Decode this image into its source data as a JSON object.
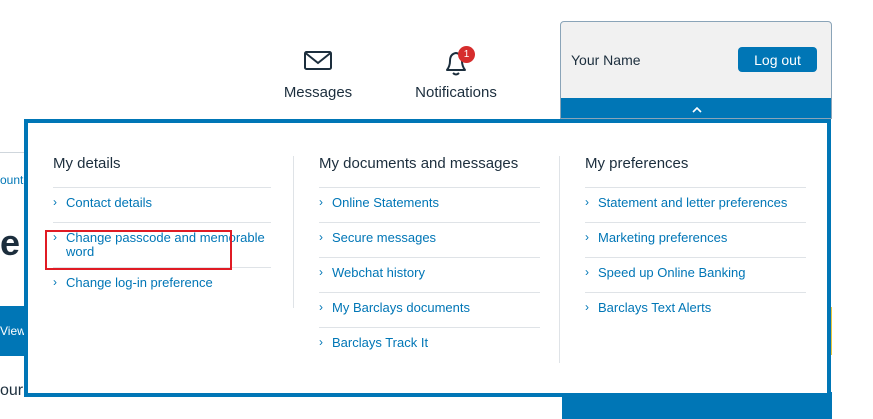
{
  "nav": {
    "messages_label": "Messages",
    "notifications_label": "Notifications",
    "notification_count": "1"
  },
  "account": {
    "name": "Your Name",
    "logout_label": "Log out"
  },
  "background": {
    "frag_1": "ount",
    "frag_2": "e",
    "view_label": "View",
    "frag_3": "our"
  },
  "menu": {
    "columns": [
      {
        "title": "My details",
        "items": [
          "Contact details",
          "Change passcode and memorable word",
          "Change log-in preference"
        ]
      },
      {
        "title": "My documents and messages",
        "items": [
          "Online Statements",
          "Secure messages",
          "Webchat history",
          "My Barclays documents",
          "Barclays Track It"
        ]
      },
      {
        "title": "My preferences",
        "items": [
          "Statement and letter preferences",
          "Marketing preferences",
          "Speed up Online Banking",
          "Barclays Text Alerts"
        ]
      }
    ]
  },
  "colors": {
    "accent": "#0076b6",
    "text": "#1c2e3d",
    "badge": "#d62d2d",
    "highlight": "#e01b24"
  }
}
